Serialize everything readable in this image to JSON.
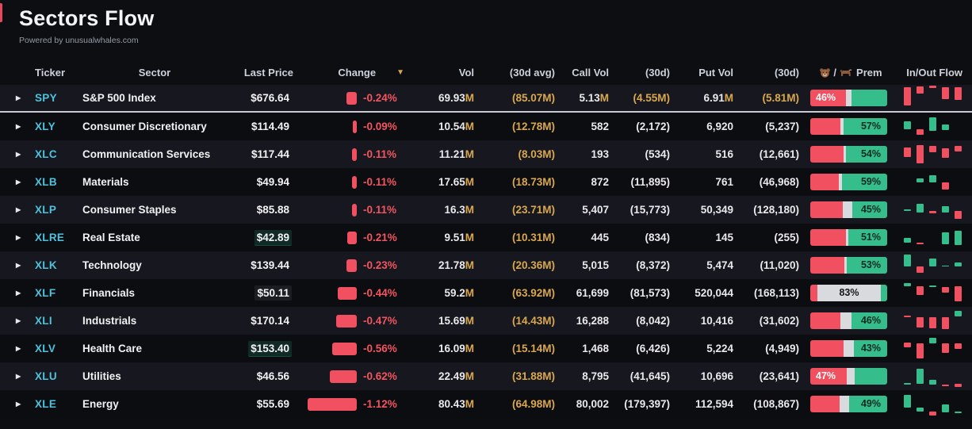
{
  "page": {
    "title": "Sectors Flow",
    "subtitle": "Powered by unusualwhales.com"
  },
  "colors": {
    "background": "#0d0e12",
    "row_light": "#17181f",
    "row_dark": "#0c0d11",
    "accent_red": "#f0505f",
    "accent_green": "#35bd8b",
    "accent_gold": "#d9a84e",
    "ticker_cyan": "#4cc3dc",
    "neutral_segment": "#d8dade"
  },
  "table": {
    "headers": {
      "ticker": "Ticker",
      "sector": "Sector",
      "last_price": "Last Price",
      "change": "Change",
      "vol": "Vol",
      "vol_30d_avg": "(30d avg)",
      "call_vol": "Call Vol",
      "call_30d": "(30d)",
      "put_vol": "Put Vol",
      "put_30d": "(30d)",
      "prem": "Prem",
      "prem_icons": "bear/bull",
      "in_out_flow": "In/Out Flow"
    },
    "sort": {
      "column": "change",
      "direction": "desc"
    },
    "rows": [
      {
        "ticker": "SPY",
        "sector": "S&P 500 Index",
        "last_price": "$676.64",
        "price_flash": null,
        "change": "-0.24%",
        "change_mag": 0.24,
        "vol": "69.93M",
        "vol_30d": "(85.07M)",
        "call_vol": "5.13M",
        "call_30d": "(4.55M)",
        "put_vol": "6.91M",
        "put_30d": "(5.81M)",
        "prem": {
          "red": 46,
          "neutral": 8,
          "green": 46,
          "label": "46%",
          "label_side": "red"
        },
        "flow": [
          [
            "r",
            6,
            76
          ],
          [
            "r",
            3,
            28
          ],
          [
            "r",
            0,
            9
          ],
          [
            "r",
            5,
            50
          ],
          [
            "r",
            5,
            53
          ]
        ],
        "pinned": true
      },
      {
        "ticker": "XLY",
        "sector": "Consumer Discretionary",
        "last_price": "$114.49",
        "price_flash": null,
        "change": "-0.09%",
        "change_mag": 0.09,
        "vol": "10.54M",
        "vol_30d": "(12.78M)",
        "call_vol": "582",
        "call_30d": "(2,172)",
        "put_vol": "6,920",
        "put_30d": "(5,237)",
        "prem": {
          "red": 39,
          "neutral": 4,
          "green": 57,
          "label": "57%",
          "label_side": "green"
        },
        "flow": [
          [
            "g",
            30,
            32
          ],
          [
            "r",
            62,
            22
          ],
          [
            "g",
            14,
            53
          ],
          [
            "g",
            43,
            20
          ],
          null
        ],
        "pinned": false
      },
      {
        "ticker": "XLC",
        "sector": "Communication Services",
        "last_price": "$117.44",
        "price_flash": null,
        "change": "-0.11%",
        "change_mag": 0.11,
        "vol": "11.21M",
        "vol_30d": "(8.03M)",
        "call_vol": "193",
        "call_30d": "(534)",
        "put_vol": "516",
        "put_30d": "(12,661)",
        "prem": {
          "red": 43,
          "neutral": 3,
          "green": 54,
          "label": "54%",
          "label_side": "green"
        },
        "flow": [
          [
            "r",
            24,
            38
          ],
          [
            "r",
            12,
            75
          ],
          [
            "r",
            17,
            24
          ],
          [
            "r",
            27,
            37
          ],
          [
            "r",
            17,
            23
          ]
        ],
        "pinned": false
      },
      {
        "ticker": "XLB",
        "sector": "Materials",
        "last_price": "$49.94",
        "price_flash": null,
        "change": "-0.11%",
        "change_mag": 0.11,
        "vol": "17.65M",
        "vol_30d": "(18.73M)",
        "call_vol": "872",
        "call_30d": "(11,895)",
        "put_vol": "761",
        "put_30d": "(46,968)",
        "prem": {
          "red": 37,
          "neutral": 4,
          "green": 59,
          "label": "59%",
          "label_side": "green"
        },
        "flow": [
          null,
          [
            "g",
            34,
            18
          ],
          [
            "g",
            24,
            28
          ],
          [
            "r",
            52,
            30
          ],
          null
        ],
        "pinned": false
      },
      {
        "ticker": "XLP",
        "sector": "Consumer Staples",
        "last_price": "$85.88",
        "price_flash": null,
        "change": "-0.11%",
        "change_mag": 0.11,
        "vol": "16.3M",
        "vol_30d": "(23.71M)",
        "call_vol": "5,407",
        "call_30d": "(15,773)",
        "put_vol": "50,349",
        "put_30d": "(128,180)",
        "prem": {
          "red": 42,
          "neutral": 13,
          "green": 45,
          "label": "45%",
          "label_side": "green"
        },
        "flow": [
          [
            "g",
            48,
            6
          ],
          [
            "g",
            25,
            37
          ],
          [
            "r",
            55,
            8
          ],
          [
            "g",
            35,
            27
          ],
          [
            "r",
            55,
            33
          ]
        ],
        "pinned": false
      },
      {
        "ticker": "XLRE",
        "sector": "Real Estate",
        "last_price": "$42.89",
        "price_flash": "green",
        "change": "-0.21%",
        "change_mag": 0.21,
        "vol": "9.51M",
        "vol_30d": "(10.31M)",
        "call_vol": "445",
        "call_30d": "(834)",
        "put_vol": "145",
        "put_30d": "(255)",
        "prem": {
          "red": 46,
          "neutral": 3,
          "green": 51,
          "label": "51%",
          "label_side": "green"
        },
        "flow": [
          [
            "g",
            52,
            18
          ],
          [
            "r",
            72,
            6
          ],
          null,
          [
            "g",
            28,
            50
          ],
          [
            "g",
            22,
            60
          ]
        ],
        "pinned": false
      },
      {
        "ticker": "XLK",
        "sector": "Technology",
        "last_price": "$139.44",
        "price_flash": null,
        "change": "-0.23%",
        "change_mag": 0.23,
        "vol": "21.78M",
        "vol_30d": "(20.36M)",
        "call_vol": "5,015",
        "call_30d": "(8,372)",
        "put_vol": "5,474",
        "put_30d": "(11,020)",
        "prem": {
          "red": 44,
          "neutral": 3,
          "green": 53,
          "label": "53%",
          "label_side": "green"
        },
        "flow": [
          [
            "g",
            8,
            47
          ],
          [
            "r",
            55,
            26
          ],
          [
            "g",
            21,
            34
          ],
          [
            "g",
            50,
            6
          ],
          [
            "g",
            39,
            17
          ]
        ],
        "pinned": false
      },
      {
        "ticker": "XLF",
        "sector": "Financials",
        "last_price": "$50.11",
        "price_flash": "dim",
        "change": "-0.44%",
        "change_mag": 0.44,
        "vol": "59.2M",
        "vol_30d": "(63.92M)",
        "call_vol": "61,699",
        "call_30d": "(81,573)",
        "put_vol": "520,044",
        "put_30d": "(168,113)",
        "prem": {
          "red": 9,
          "neutral": 83,
          "green": 8,
          "label": "83%",
          "label_side": "gray"
        },
        "flow": [
          [
            "g",
            10,
            14
          ],
          [
            "r",
            24,
            34
          ],
          [
            "g",
            18,
            8
          ],
          [
            "r",
            27,
            22
          ],
          [
            "r",
            24,
            61
          ]
        ],
        "pinned": false
      },
      {
        "ticker": "XLI",
        "sector": "Industrials",
        "last_price": "$170.14",
        "price_flash": null,
        "change": "-0.47%",
        "change_mag": 0.47,
        "vol": "15.69M",
        "vol_30d": "(14.43M)",
        "call_vol": "16,288",
        "call_30d": "(8,042)",
        "put_vol": "10,416",
        "put_30d": "(31,602)",
        "prem": {
          "red": 39,
          "neutral": 15,
          "green": 46,
          "label": "46%",
          "label_side": "green"
        },
        "flow": [
          [
            "r",
            30,
            6
          ],
          [
            "r",
            36,
            40
          ],
          [
            "r",
            36,
            45
          ],
          [
            "r",
            36,
            49
          ],
          [
            "g",
            10,
            22
          ]
        ],
        "pinned": false
      },
      {
        "ticker": "XLV",
        "sector": "Health Care",
        "last_price": "$153.40",
        "price_flash": "green",
        "change": "-0.56%",
        "change_mag": 0.56,
        "vol": "16.09M",
        "vol_30d": "(15.14M)",
        "call_vol": "1,468",
        "call_30d": "(6,426)",
        "put_vol": "5,224",
        "put_30d": "(4,949)",
        "prem": {
          "red": 43,
          "neutral": 14,
          "green": 43,
          "label": "43%",
          "label_side": "green"
        },
        "flow": [
          [
            "r",
            25,
            20
          ],
          [
            "r",
            28,
            62
          ],
          [
            "g",
            8,
            20
          ],
          [
            "r",
            30,
            38
          ],
          [
            "r",
            30,
            21
          ]
        ],
        "pinned": false
      },
      {
        "ticker": "XLU",
        "sector": "Utilities",
        "last_price": "$46.56",
        "price_flash": null,
        "change": "-0.62%",
        "change_mag": 0.62,
        "vol": "22.49M",
        "vol_30d": "(31.88M)",
        "call_vol": "8,795",
        "call_30d": "(41,645)",
        "put_vol": "10,696",
        "put_30d": "(23,641)",
        "prem": {
          "red": 47,
          "neutral": 11,
          "green": 42,
          "label": "47%",
          "label_side": "red"
        },
        "flow": [
          [
            "g",
            77,
            7
          ],
          [
            "g",
            20,
            60
          ],
          [
            "g",
            63,
            21
          ],
          [
            "r",
            85,
            6
          ],
          [
            "r",
            80,
            15
          ]
        ],
        "pinned": false
      },
      {
        "ticker": "XLE",
        "sector": "Energy",
        "last_price": "$55.69",
        "price_flash": null,
        "change": "-1.12%",
        "change_mag": 1.12,
        "vol": "80.43M",
        "vol_30d": "(64.98M)",
        "call_vol": "80,002",
        "call_30d": "(179,397)",
        "put_vol": "112,594",
        "put_30d": "(108,867)",
        "prem": {
          "red": 38,
          "neutral": 13,
          "green": 49,
          "label": "49%",
          "label_side": "green"
        },
        "flow": [
          [
            "g",
            12,
            53
          ],
          [
            "g",
            64,
            16
          ],
          [
            "r",
            80,
            16
          ],
          [
            "g",
            53,
            30
          ],
          [
            "g",
            80,
            6
          ]
        ],
        "pinned": false
      }
    ]
  }
}
